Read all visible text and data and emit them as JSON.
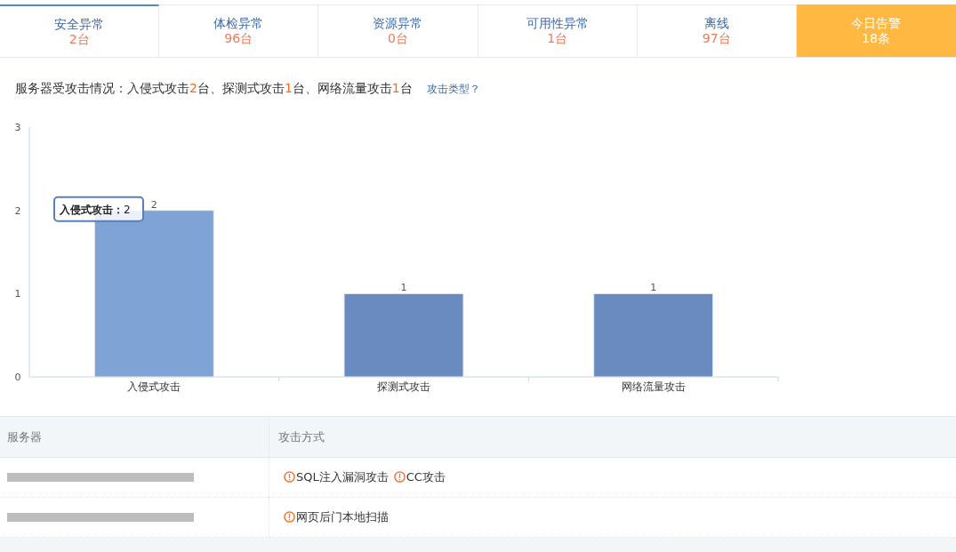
{
  "tabs": [
    {
      "label": "安全异常",
      "count": "2台",
      "selected": true,
      "kind": "normal"
    },
    {
      "label": "体检异常",
      "count": "96台",
      "selected": false,
      "kind": "normal"
    },
    {
      "label": "资源异常",
      "count": "0台",
      "selected": false,
      "kind": "normal"
    },
    {
      "label": "可用性异常",
      "count": "1台",
      "selected": false,
      "kind": "normal"
    },
    {
      "label": "离线",
      "count": "97台",
      "selected": false,
      "kind": "normal"
    },
    {
      "label": "今日告警",
      "count": "18条",
      "selected": false,
      "kind": "alert"
    }
  ],
  "summary": {
    "parts": [
      {
        "text": "服务器受攻击情况：入侵式攻击",
        "highlight": false
      },
      {
        "text": "2",
        "highlight": true
      },
      {
        "text": "台、探测式攻击",
        "highlight": false
      },
      {
        "text": "1",
        "highlight": true
      },
      {
        "text": "台、网络流量攻击",
        "highlight": false
      },
      {
        "text": "1",
        "highlight": true
      },
      {
        "text": "台",
        "highlight": false
      }
    ],
    "link": "攻击类型？"
  },
  "chart": {
    "bars": [
      {
        "color": "#7fa3d5"
      },
      {
        "color": "#6a8bbf"
      },
      {
        "color": "#6a8bbf"
      }
    ],
    "tooltip": {
      "label": "入侵式攻击：",
      "value": "2"
    },
    "chart_data": {
      "type": "bar",
      "categories": [
        "入侵式攻击",
        "探测式攻击",
        "网络流量攻击"
      ],
      "series": [
        {
          "values": [
            2,
            1,
            1
          ]
        }
      ],
      "ylim": [
        0,
        3
      ],
      "yticks": [
        0,
        1,
        2,
        3
      ],
      "data_labels": true
    }
  },
  "table": {
    "columns": [
      "服务器",
      "攻击方式"
    ],
    "rows": [
      {
        "server": {
          "kind": "redacted"
        },
        "attacks": [
          "SQL注入漏洞攻击",
          "CC攻击"
        ]
      },
      {
        "server": {
          "kind": "redacted"
        },
        "attacks": [
          "网页后门本地扫描"
        ]
      }
    ]
  }
}
